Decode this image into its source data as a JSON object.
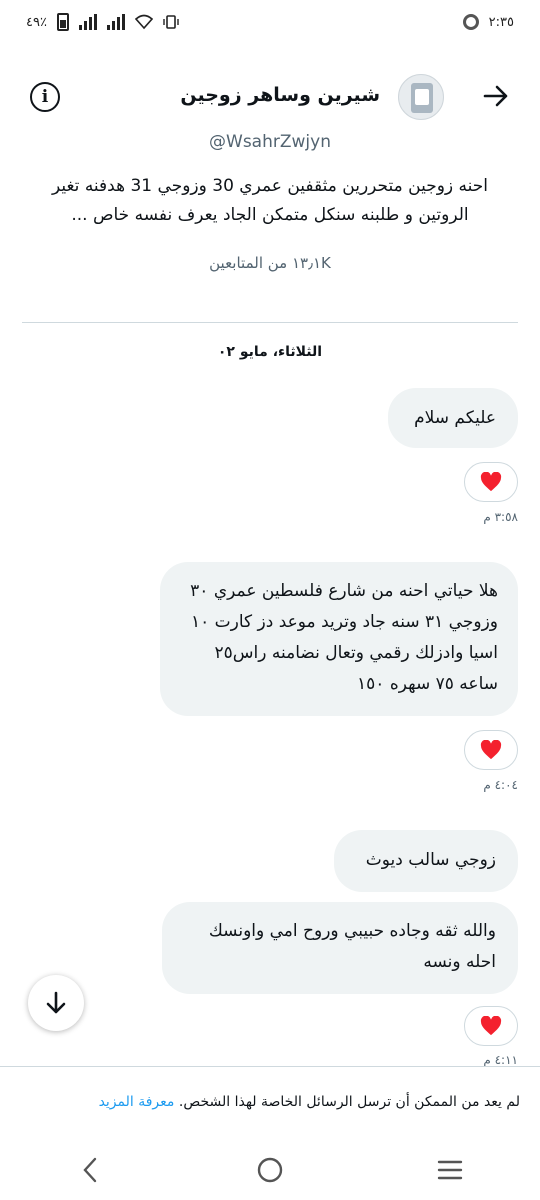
{
  "status_bar": {
    "time": "٢:٣٥",
    "battery": "٤٩٪"
  },
  "header": {
    "display_name": "شيرين وساهر زوجين",
    "handle": "@WsahrZwjyn",
    "bio": "احنه زوجين متحررين مثقفين عمري 30 وزوجي 31 هدفنه تغير الروتين و طلبنه سنكل متمكن الجاد يعرف نفسه خاص ...",
    "followers": "١٣٫١K من المتابعين"
  },
  "conversation": {
    "date_separator": "الثلاثاء، مايو ٠٢",
    "messages": [
      {
        "text": "عليكم سلام",
        "reaction": "heart-icon",
        "time": "٣:٥٨ م"
      },
      {
        "text": "هلا حياتي احنه من شارع فلسطين عمري ٣٠ وزوجي ٣١ سنه جاد وتريد موعد دز كارت ١٠ اسيا وادزلك رقمي وتعال نضامنه راس٢٥ ساعه ٧٥ سهره ١٥٠",
        "reaction": "heart-icon",
        "time": "٤:٠٤ م"
      },
      {
        "text": "زوجي سالب ديوث"
      },
      {
        "text": "والله ثقه وجاده حبيبي وروح امي واونسك احله ونسه",
        "reaction": "heart-icon",
        "time": "٤:١١ م"
      }
    ]
  },
  "footer": {
    "notice": "لم يعد من الممكن أن ترسل الرسائل الخاصة لهذا الشخص.",
    "learn_more": "معرفة المزيد"
  },
  "colors": {
    "accent": "#1d9bf0",
    "bubble": "#eff3f4",
    "heart": "#f4212e"
  }
}
